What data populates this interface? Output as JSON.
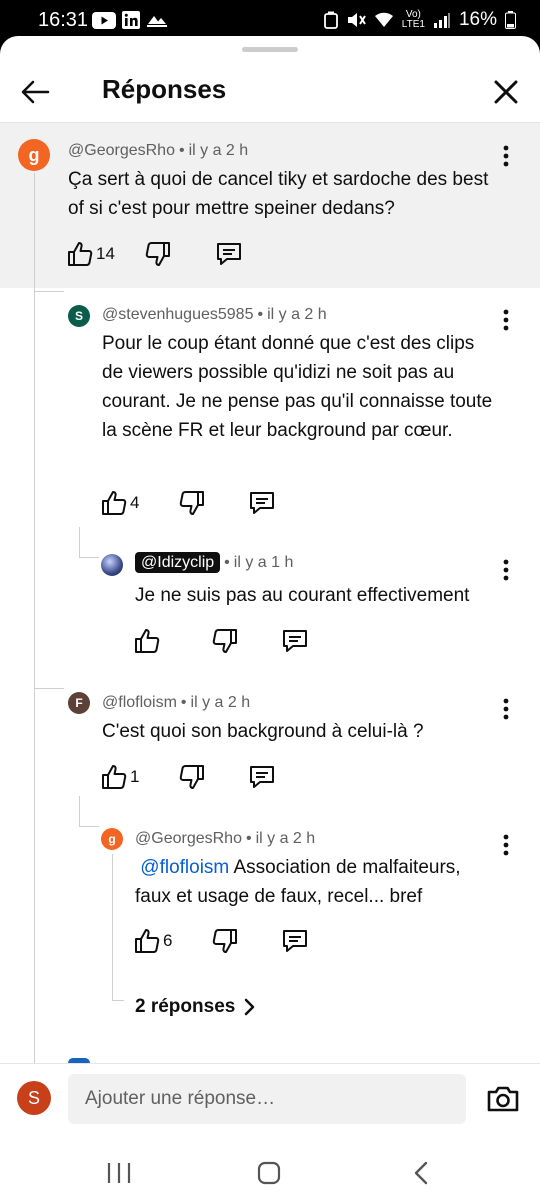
{
  "status_bar": {
    "time": "16:31",
    "battery": "16%",
    "network": "LTE1"
  },
  "header": {
    "title": "Réponses"
  },
  "comments": [
    {
      "avatar_letter": "g",
      "avatar_color": "#f26522",
      "author": "@GeorgesRho",
      "time": "il y a 2 h",
      "text": "Ça sert à quoi de cancel tiky et sardoche des best of si c'est pour mettre speiner dedans?",
      "likes": "14"
    },
    {
      "avatar_letter": "S",
      "avatar_color": "#0b5c4a",
      "author": "@stevenhugues5985",
      "time": "il y a 2 h",
      "text": "Pour le coup étant donné que c'est des clips de viewers possible qu'idizi ne soit pas au courant. Je ne pense pas qu'il connaisse toute la scène FR et leur background par cœur.",
      "likes": "4"
    },
    {
      "avatar_letter": "",
      "avatar_color": "#3a4a8a",
      "author": "@Idizyclip",
      "time": "il y a 1 h",
      "text": "Je ne suis pas au courant effectivement",
      "likes": ""
    },
    {
      "avatar_letter": "F",
      "avatar_color": "#5d4037",
      "author": "@flofloism",
      "time": "il y a 2 h",
      "text": "C'est quoi son background à celui-là ?",
      "likes": "1"
    },
    {
      "avatar_letter": "g",
      "avatar_color": "#f26522",
      "author": "@GeorgesRho",
      "time": "il y a 2 h",
      "mention": "@flofloism",
      "text": "Association de malfaiteurs, faux et usage de faux, recel... bref",
      "likes": "6"
    }
  ],
  "more_replies": {
    "label": "2 réponses"
  },
  "reply_box": {
    "avatar_letter": "S",
    "avatar_color": "#c8401a",
    "placeholder": "Ajouter une réponse…"
  },
  "icons": [
    "back-arrow-icon",
    "close-icon",
    "more-vert-icon",
    "thumb-up-icon",
    "thumb-down-icon",
    "reply-icon",
    "chevron-right-icon",
    "camera-icon",
    "recent-apps-icon",
    "home-icon",
    "back-nav-icon"
  ]
}
